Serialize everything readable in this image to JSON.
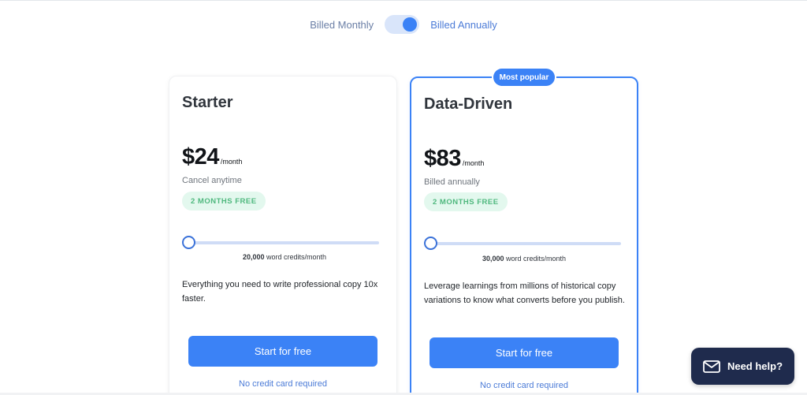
{
  "billing": {
    "monthly_label": "Billed Monthly",
    "annual_label": "Billed Annually",
    "annual_selected": true
  },
  "plans": [
    {
      "name": "Starter",
      "price": "$24",
      "period": "/month",
      "note": "Cancel anytime",
      "badge": "2 MONTHS FREE",
      "credits_value": "20,000",
      "credits_unit": "word credits/month",
      "slider_level": 0,
      "description": "Everything you need to write professional copy 10x faster.",
      "cta": "Start for free",
      "footnote": "No credit card required"
    },
    {
      "name": "Data-Driven",
      "ribbon": "Most popular",
      "price": "$83",
      "period": "/month",
      "note": "Billed annually",
      "badge": "2 MONTHS FREE",
      "credits_value": "30,000",
      "credits_unit": "word credits/month",
      "slider_level": 0,
      "description": "Leverage learnings from millions of historical copy variations to know what converts before you publish.",
      "cta": "Start for free",
      "footnote": "No credit card required"
    }
  ],
  "help": {
    "label": "Need help?",
    "icon": "mail-icon"
  },
  "colors": {
    "accent": "#3b82f6",
    "badge_bg": "#e3f8ee",
    "badge_text": "#4fb87e",
    "help_bg": "#1f2b4d"
  }
}
